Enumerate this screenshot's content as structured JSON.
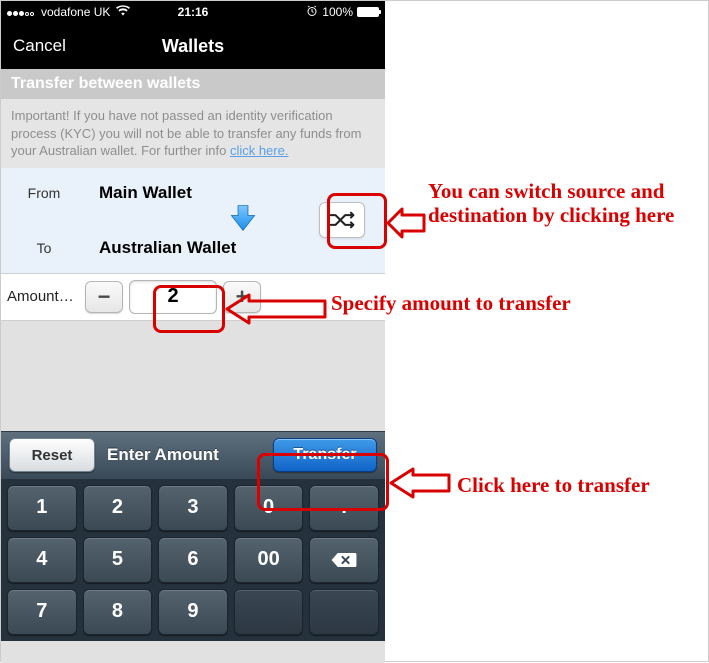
{
  "status": {
    "carrier": "vodafone UK",
    "time": "21:16",
    "battery": "100%"
  },
  "nav": {
    "cancel": "Cancel",
    "title": "Wallets"
  },
  "section_head": "Transfer between wallets",
  "info": {
    "text": "Important! If you have not passed an identity verification process (KYC) you will not be able to transfer any funds from your Australian wallet. For further info ",
    "link": "click here."
  },
  "wallets": {
    "from_label": "From",
    "from_value": "Main Wallet",
    "to_label": "To",
    "to_value": "Australian Wallet"
  },
  "amount": {
    "label": "Amount…",
    "value": "2",
    "minus": "−",
    "plus": "+"
  },
  "toolbar": {
    "reset": "Reset",
    "enter": "Enter Amount",
    "transfer": "Transfer"
  },
  "keys": [
    "1",
    "2",
    "3",
    "0",
    ".",
    "4",
    "5",
    "6",
    "00",
    "back",
    "7",
    "8",
    "9",
    "",
    ""
  ],
  "annotations": {
    "swap": "You can switch source and destination by clicking here",
    "amount": "Specify amount to transfer",
    "transfer": "Click here to transfer"
  }
}
